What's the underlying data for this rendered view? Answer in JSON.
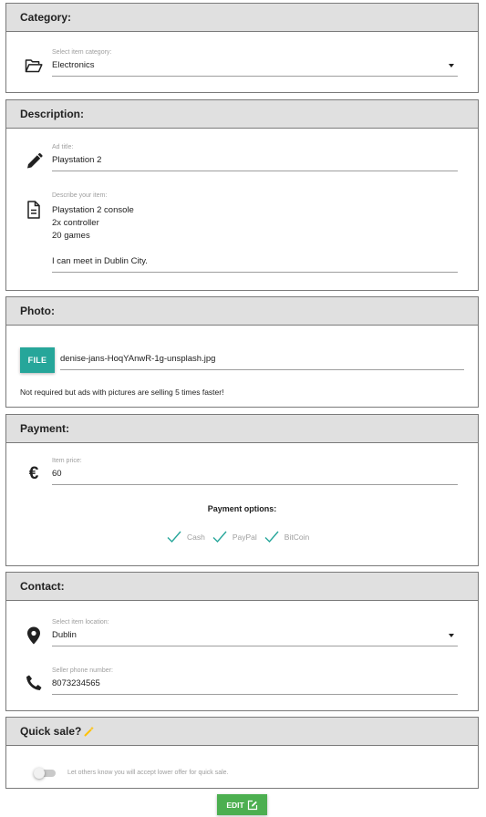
{
  "category": {
    "heading": "Category:",
    "select_label": "Select item category:",
    "select_value": "Electronics",
    "icon": "folder-open-icon"
  },
  "description": {
    "heading": "Description:",
    "title_label": "Ad title:",
    "title_value": "Playstation 2",
    "desc_label": "Describe your item:",
    "desc_value": "Playstation 2 console\n2x controller\n20 games\n\nI can meet in Dublin City."
  },
  "photo": {
    "heading": "Photo:",
    "file_button": "FILE",
    "file_name": "denise-jans-HoqYAnwR-1g-unsplash.jpg",
    "hint": "Not required but ads with pictures are selling 5 times faster!"
  },
  "payment": {
    "heading": "Payment:",
    "price_label": "Item price:",
    "price_value": "60",
    "options_title": "Payment options:",
    "options": [
      {
        "label": "Cash",
        "checked": true
      },
      {
        "label": "PayPal",
        "checked": true
      },
      {
        "label": "BitCoin",
        "checked": true
      }
    ]
  },
  "contact": {
    "heading": "Contact:",
    "location_label": "Select item location:",
    "location_value": "Dublin",
    "phone_label": "Seller phone number:",
    "phone_value": "8073234565"
  },
  "quick_sale": {
    "heading": "Quick sale?",
    "toggle_text": "Let others know you will accept lower offer for quick sale.",
    "toggle_on": false
  },
  "edit_button": "EDIT",
  "colors": {
    "accent_teal": "#26a69a",
    "edit_green": "#4caf50",
    "header_gray": "#e0e0e0",
    "check_teal": "#26a69a",
    "wand_yellow": "#ffc107"
  }
}
